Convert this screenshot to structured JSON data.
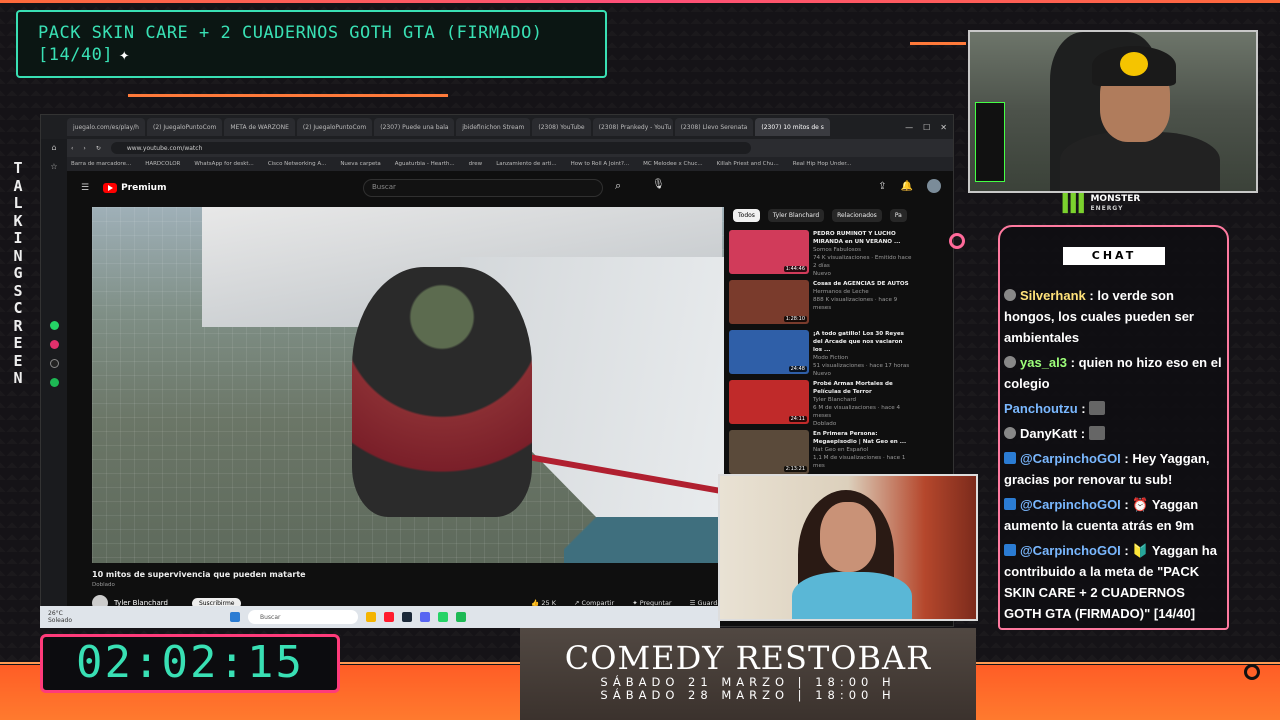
{
  "goal": {
    "text": "PACK SKIN CARE + 2 CUADERNOS GOTH GTA (FIRMADO) [14/40]"
  },
  "side_label": {
    "letters": [
      "T",
      "A",
      "L",
      "K",
      "I",
      "N",
      "G",
      "S",
      "C",
      "R",
      "E",
      "E",
      "N"
    ]
  },
  "browser": {
    "tabs": [
      "juegalo.com/es/play/h",
      "(2) JuegaloPuntoCom",
      "META de WARZONE",
      "(2) JuegaloPuntoCom",
      "(2307) Puede una bala",
      "jbidefinichon Stream",
      "(2308) YouTube",
      "(2308) Prankedy - YouTu",
      "(2308) Llevo Serenata",
      "(2307) 10 mitos de s"
    ],
    "url": "www.youtube.com/watch",
    "bookmarks": [
      "Barra de marcadore...",
      "HARDCOLOR",
      "WhatsApp for deskt...",
      "Cisco Networking A...",
      "Nueva carpeta",
      "Aguaturbia - Hearth...",
      "drew",
      "Lanzamiento de arti...",
      "How to Roll A Joint?...",
      "MC Melodee x Chuc...",
      "Killah Priest and Chu...",
      "Real Hip Hop Under..."
    ]
  },
  "youtube": {
    "logo": "Premium",
    "search_placeholder": "Buscar",
    "video_title": "10 mitos de supervivencia que pueden matarte",
    "video_sub": "Doblado",
    "channel": "Tyler Blanchard",
    "subscribe": "Suscribirme",
    "likes": "25 K",
    "share": "Compartir",
    "ask": "Preguntar",
    "save": "Guardar",
    "chips": [
      "Todos",
      "Tyler Blanchard",
      "Relacionados",
      "Pa"
    ],
    "related": [
      {
        "title": "PEDRO RUMINOT Y LUCHO MIRANDA en UN VERANO ...",
        "channel": "Somos Fabulosos",
        "meta": "74 K visualizaciones · Emitido hace 2 días",
        "badge": "Nuevo",
        "duration": "1:44:46",
        "color": "#d13b5a"
      },
      {
        "title": "Cosas de AGENCIAS DE AUTOS",
        "channel": "Hermanos de Leche",
        "meta": "888 K visualizaciones · hace 9 meses",
        "badge": "",
        "duration": "1:28:10",
        "color": "#7a3b2c"
      },
      {
        "title": "¡A todo gatillo! Los 30 Reyes del Arcade que nos vaciaron los ...",
        "channel": "Modo Fiction",
        "meta": "51 visualizaciones · hace 17 horas",
        "badge": "Nuevo",
        "duration": "24:48",
        "color": "#2f5fa8"
      },
      {
        "title": "Probé Armas Mortales de Películas de Terror",
        "channel": "Tyler Blanchard",
        "meta": "6 M de visualizaciones · hace 4 meses",
        "badge": "Doblado",
        "duration": "24:11",
        "color": "#c02a2a"
      },
      {
        "title": "En Primera Persona: Megaepisodio | Nat Geo en ...",
        "channel": "Nat Geo en Español",
        "meta": "1,1 M de visualizaciones · hace 1 mes",
        "badge": "",
        "duration": "2:13:21",
        "color": "#5a4a3a"
      }
    ]
  },
  "taskbar": {
    "temp": "26°C",
    "weather": "Soleado",
    "search": "Buscar"
  },
  "monster": {
    "brand": "MONSTER",
    "sub": "ENERGY"
  },
  "chat": {
    "label": "CHAT",
    "messages": [
      {
        "user": "Silverhank",
        "color": "#ffe27a",
        "text": ": lo verde son hongos, los cuales pueden ser ambientales",
        "badge": "round"
      },
      {
        "user": "yas_al3",
        "color": "#9dff7a",
        "text": ": quien no hizo eso en el colegio",
        "badge": "round"
      },
      {
        "user": "Panchoutzu",
        "color": "#7ab8ff",
        "text": ":",
        "badge": "none",
        "emote": true
      },
      {
        "user": "DanyKatt",
        "color": "#ffffff",
        "text": ":",
        "badge": "round",
        "emote": true
      },
      {
        "user": "@CarpinchoGOI",
        "color": "#7ab8ff",
        "text": ": Hey Yaggan, gracias por renovar tu sub!",
        "badge": "blue"
      },
      {
        "user": "@CarpinchoGOI",
        "color": "#7ab8ff",
        "text": ": ⏰ Yaggan aumento la cuenta atrás en 9m",
        "badge": "blue"
      },
      {
        "user": "@CarpinchoGOI",
        "color": "#7ab8ff",
        "text": ": 🔰 Yaggan ha contribuido a la meta de \"PACK SKIN CARE + 2 CUADERNOS GOTH GTA (FIRMADO)\" [14/40]",
        "badge": "blue"
      }
    ]
  },
  "banner": {
    "title": "COMEDY RESTOBAR",
    "line1": "SÁBADO 21 MARZO | 18:00 H",
    "line2": "SÁBADO 28 MARZO | 18:00 H"
  },
  "timer": {
    "value": "02:02:15"
  },
  "colors": {
    "accent_green": "#39e0b4",
    "accent_pink": "#ff3b7a",
    "accent_orange": "#ff7a3a"
  }
}
